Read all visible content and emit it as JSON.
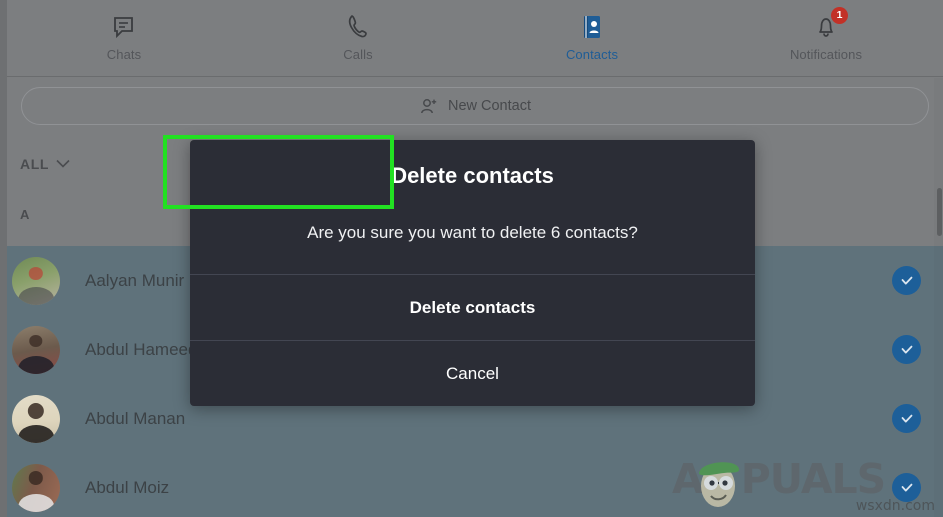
{
  "window": {
    "overlay_color": "#7c7e80",
    "accent_blue": "#1d5f99",
    "badge_red": "#c23127",
    "highlight_green": "#22e122",
    "row_selected_bg": "#5f727b"
  },
  "topnav": {
    "items": [
      {
        "label": "Chats",
        "icon": "chat-bubble-icon",
        "active": false,
        "badge": null
      },
      {
        "label": "Calls",
        "icon": "phone-handset-icon",
        "active": false,
        "badge": null
      },
      {
        "label": "Contacts",
        "icon": "contact-book-icon",
        "active": true,
        "badge": null
      },
      {
        "label": "Notifications",
        "icon": "bell-icon",
        "active": false,
        "badge": "1"
      }
    ]
  },
  "toolbar": {
    "new_contact_label": "New Contact",
    "new_contact_icon": "person-plus-icon"
  },
  "filter": {
    "label": "ALL",
    "icon": "chevron-down-icon"
  },
  "list": {
    "section_header": "A",
    "contacts": [
      {
        "name": "Aalyan Munir",
        "selected": true,
        "check_icon": "check-circle-icon"
      },
      {
        "name": "Abdul Hameed",
        "selected": true,
        "check_icon": "check-circle-icon"
      },
      {
        "name": "Abdul Manan",
        "selected": true,
        "check_icon": "check-circle-icon"
      },
      {
        "name": "Abdul Moiz",
        "selected": true,
        "check_icon": "check-circle-icon"
      }
    ]
  },
  "modal": {
    "title": "Delete contacts",
    "message": "Are you sure you want to delete 6 contacts?",
    "confirm_label": "Delete contacts",
    "cancel_label": "Cancel"
  },
  "watermarks": {
    "brand": "PUALS",
    "brand_prefix": "A",
    "source": "wsxdn.com"
  }
}
